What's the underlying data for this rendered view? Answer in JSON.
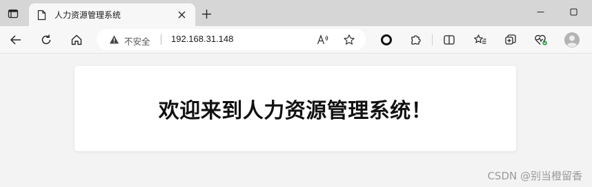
{
  "tab": {
    "title": "人力资源管理系统"
  },
  "addressbar": {
    "security_label": "不安全",
    "url": "192.168.31.148"
  },
  "page": {
    "heading": "欢迎来到人力资源管理系统！"
  },
  "watermark": {
    "text": "CSDN @别当橙留香"
  },
  "colors": {
    "tabstrip_bg": "#d6d6d6",
    "toolbar_bg": "#f7f7f7",
    "page_bg": "#f3f3f3",
    "card_bg": "#ffffff",
    "heading_color": "#111111",
    "profile_badge_green": "#2e9d46"
  },
  "icons": {
    "tab_actions": "tab-actions-icon",
    "page_favicon": "document-icon",
    "tab_close": "close-icon",
    "new_tab": "plus-icon",
    "minimize": "minimize-icon",
    "maximize": "maximize-icon",
    "back": "back-arrow-icon",
    "refresh": "refresh-icon",
    "home": "home-icon",
    "not_secure": "warning-icon",
    "read_aloud": "read-aloud-icon",
    "favorite": "star-icon",
    "extension_circle": "circle-extension-icon",
    "extensions": "puzzle-icon",
    "split_screen": "split-screen-icon",
    "favorites": "favorites-icon",
    "collections": "collections-icon",
    "browser_essentials": "heart-pulse-icon",
    "profile": "profile-avatar-icon"
  }
}
